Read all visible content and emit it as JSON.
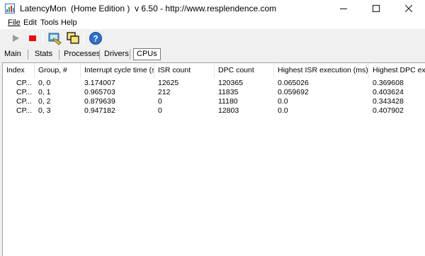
{
  "window": {
    "title": "LatencyMon  (Home Edition )  v 6.50 - http://www.resplendence.com",
    "minimize": "—",
    "maximize": "☐",
    "close": "✕"
  },
  "menu": {
    "items": [
      {
        "label": "File"
      },
      {
        "label": "Edit"
      },
      {
        "label": "Tools"
      },
      {
        "label": "Help"
      }
    ]
  },
  "toolbar": {
    "buttons": [
      {
        "name": "play-icon"
      },
      {
        "name": "stop-icon"
      },
      {
        "name": "driver-icon"
      },
      {
        "name": "copy-icon"
      },
      {
        "name": "help-icon"
      }
    ]
  },
  "tabs": [
    {
      "label": "Main"
    },
    {
      "label": "Stats"
    },
    {
      "label": "Processes"
    },
    {
      "label": "Drivers"
    },
    {
      "label": "CPUs",
      "active": true
    }
  ],
  "table": {
    "columns": [
      "Index",
      "Group, #",
      "Interrupt cycle time (s)",
      "ISR count",
      "DPC count",
      "Highest ISR execution (ms)",
      "Highest DPC exec"
    ],
    "rows": [
      [
        "CP...",
        "0, 0",
        "3.174007",
        "12625",
        "120365",
        "0.065026",
        "0.369608"
      ],
      [
        "CP...",
        "0, 1",
        "0.965703",
        "212",
        "11835",
        "0.059692",
        "0.403624"
      ],
      [
        "CP...",
        "0, 2",
        "0.879639",
        "0",
        "11180",
        "0.0",
        "0.343428"
      ],
      [
        "CP...",
        "0, 3",
        "0.947182",
        "0",
        "12803",
        "0.0",
        "0.407902"
      ]
    ]
  }
}
